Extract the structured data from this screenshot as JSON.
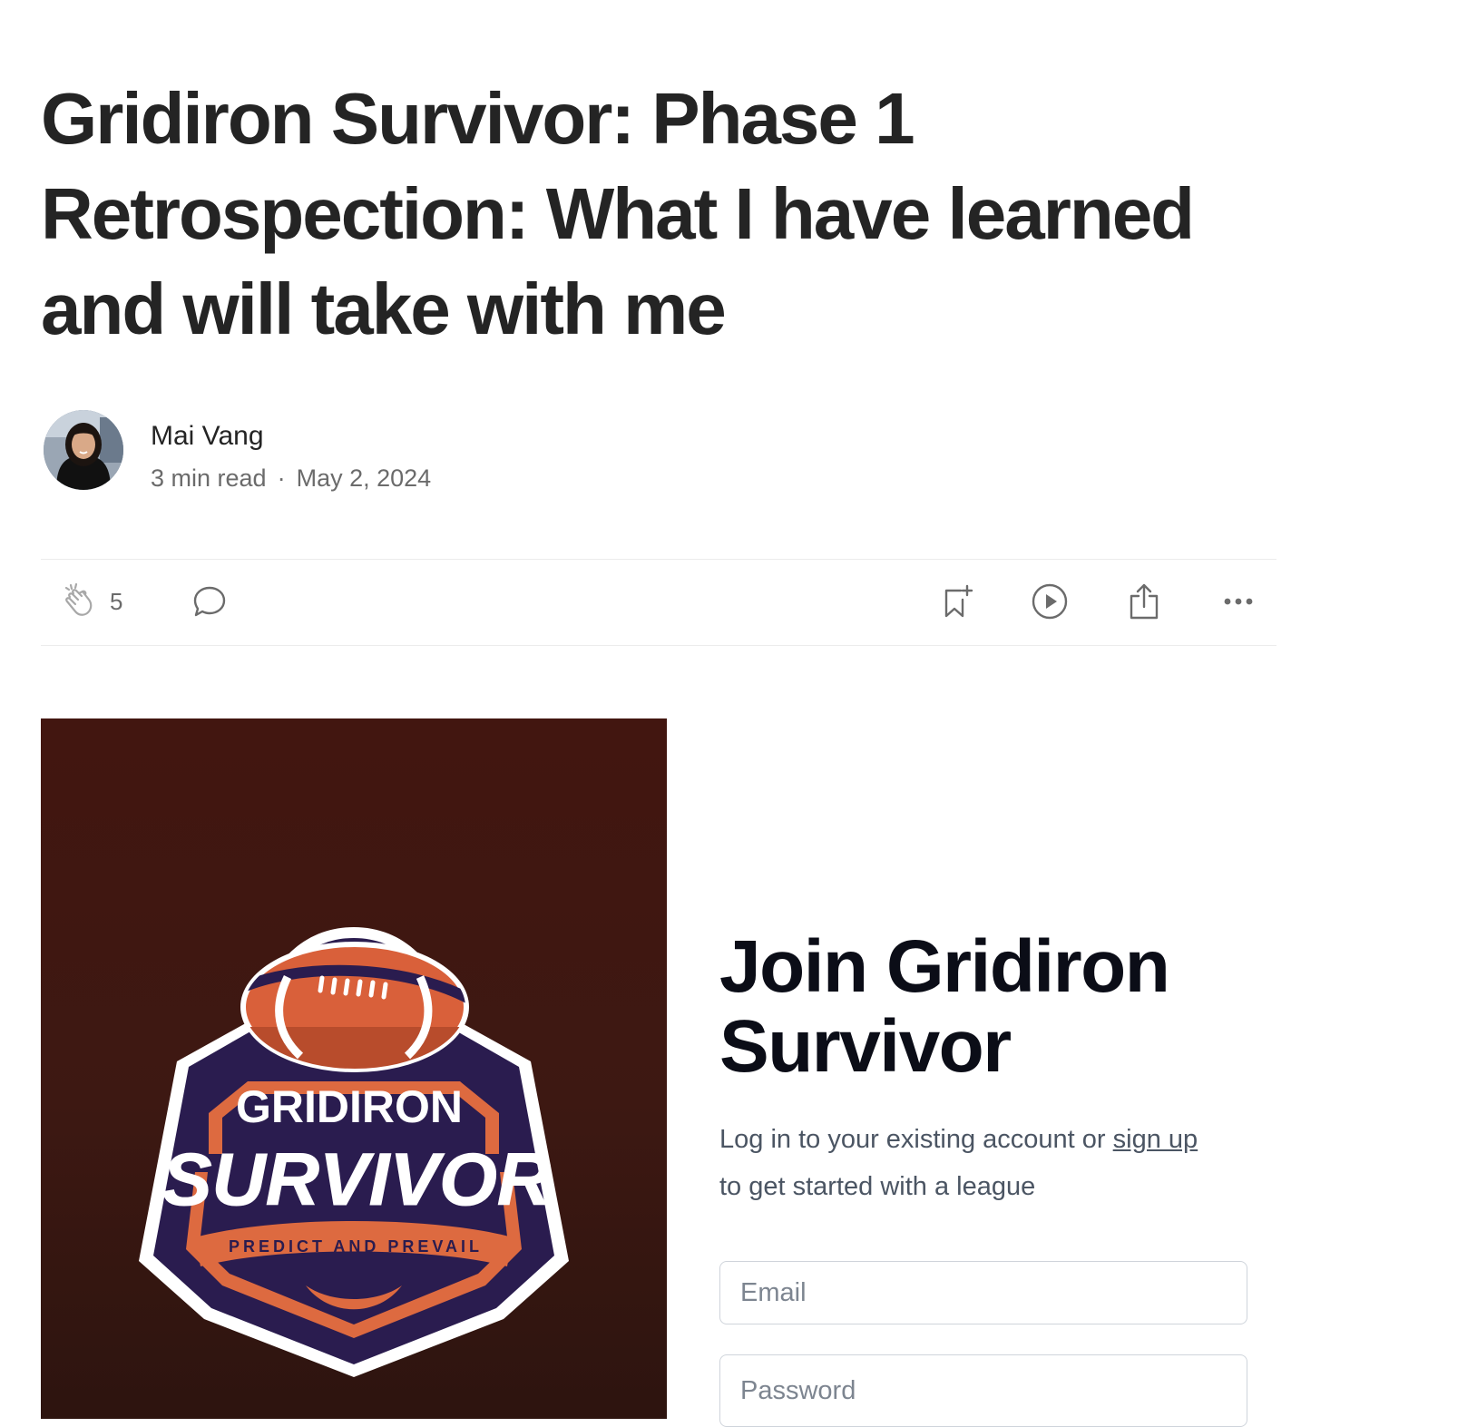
{
  "article": {
    "title": "Gridiron Survivor: Phase 1 Retrospection: What I have learned and will take with me"
  },
  "author": {
    "name": "Mai Vang",
    "read_time": "3 min read",
    "separator": "·",
    "date": "May 2, 2024"
  },
  "actions": {
    "clap_count": "5",
    "icons": [
      "clap-icon",
      "comment-icon",
      "bookmark-add-icon",
      "play-icon",
      "share-icon",
      "more-icon"
    ]
  },
  "hero_image": {
    "logo_line1": "GRIDIRON",
    "logo_line2": "SURVIVOR",
    "logo_tagline": "PREDICT AND PREVAIL"
  },
  "join": {
    "heading": "Join Gridiron Survivor",
    "subtitle_before": "Log in to your existing account or",
    "signup_link": "sign up",
    "subtitle_after": "to get started with a league",
    "email_placeholder": "Email",
    "password_placeholder": "Password"
  },
  "colors": {
    "text": "#242424",
    "muted": "#6b6b6b",
    "hero_bg": "#3d1812",
    "logo_navy": "#2a1c4f",
    "logo_orange": "#dd6a40"
  }
}
